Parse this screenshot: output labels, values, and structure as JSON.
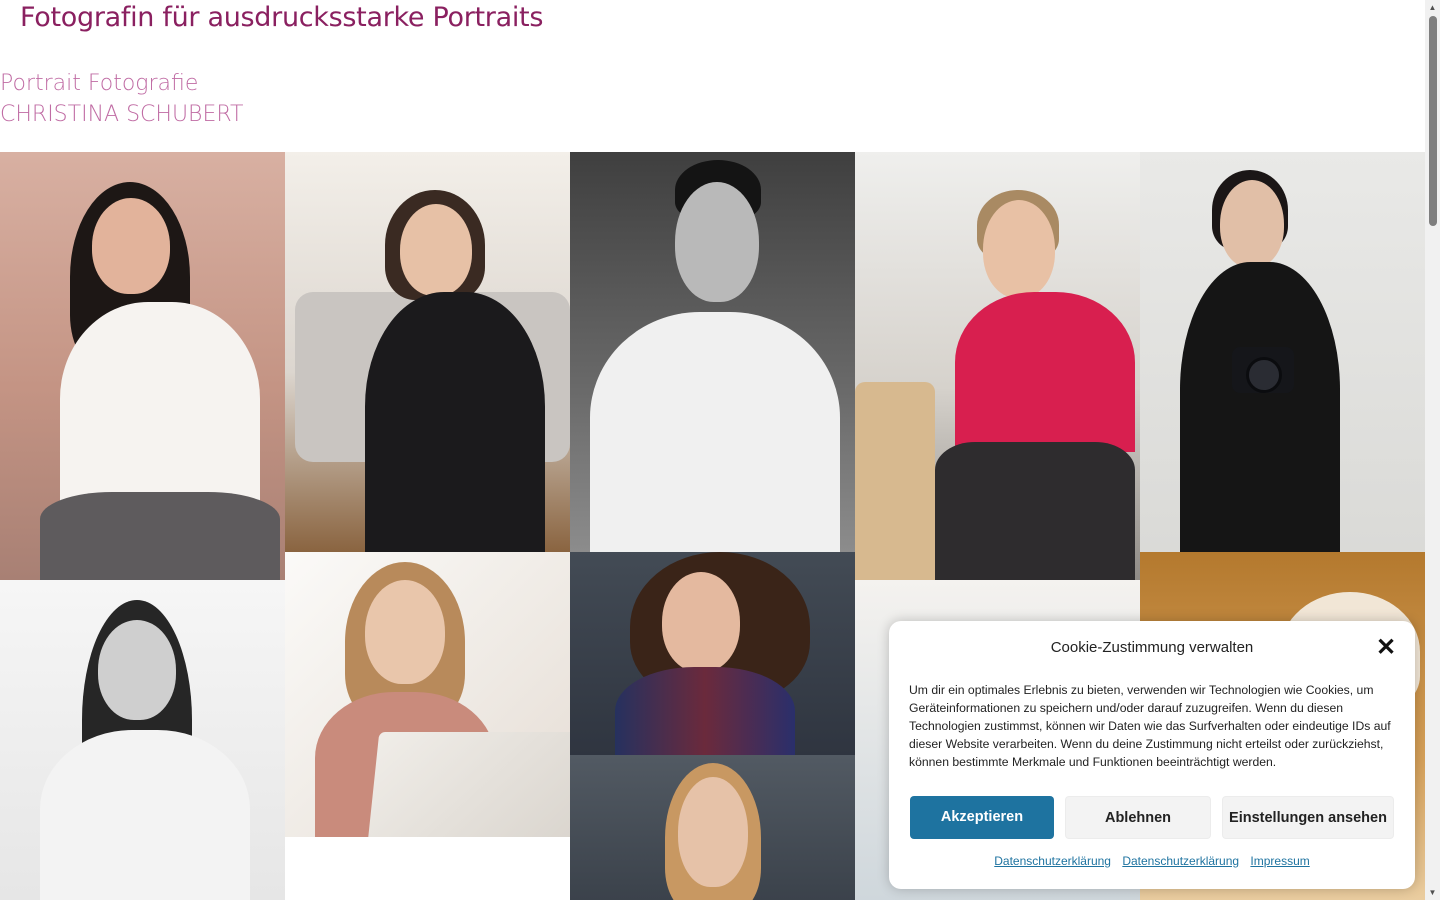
{
  "page": {
    "headline": "Fotografin für ausdrucksstarke Portraits",
    "brand_line1": "Portrait Fotografie",
    "brand_line2": "CHRISTINA SCHUBERT"
  },
  "colors": {
    "headline": "#8a2060",
    "brand": "#c06ca4",
    "accent_button": "#1e73a0"
  },
  "gallery": {
    "photos": [
      "portrait-woman-white-shirt-laughing",
      "portrait-woman-black-blazer-sofa",
      "portrait-man-white-shirt-bw",
      "portrait-woman-pink-blouse",
      "portrait-woman-with-camera",
      "portrait-woman-white-blouse-bw",
      "portrait-woman-laptop",
      "portrait-woman-patterned-dress",
      "portrait-woman-blonde",
      "portrait-partial",
      "portrait-partial-curtains"
    ]
  },
  "cookie_banner": {
    "title": "Cookie-Zustimmung verwalten",
    "text": "Um dir ein optimales Erlebnis zu bieten, verwenden wir Technologien wie Cookies, um Geräteinformationen zu speichern und/oder darauf zuzugreifen. Wenn du diesen Technologien zustimmst, können wir Daten wie das Surfverhalten oder eindeutige IDs auf dieser Website verarbeiten. Wenn du deine Zustimmung nicht erteilst oder zurückziehst, können bestimmte Merkmale und Funktionen beeinträchtigt werden.",
    "accept_label": "Akzeptieren",
    "deny_label": "Ablehnen",
    "settings_label": "Einstellungen ansehen",
    "links": [
      "Datenschutzerklärung",
      "Datenschutzerklärung",
      "Impressum"
    ]
  }
}
